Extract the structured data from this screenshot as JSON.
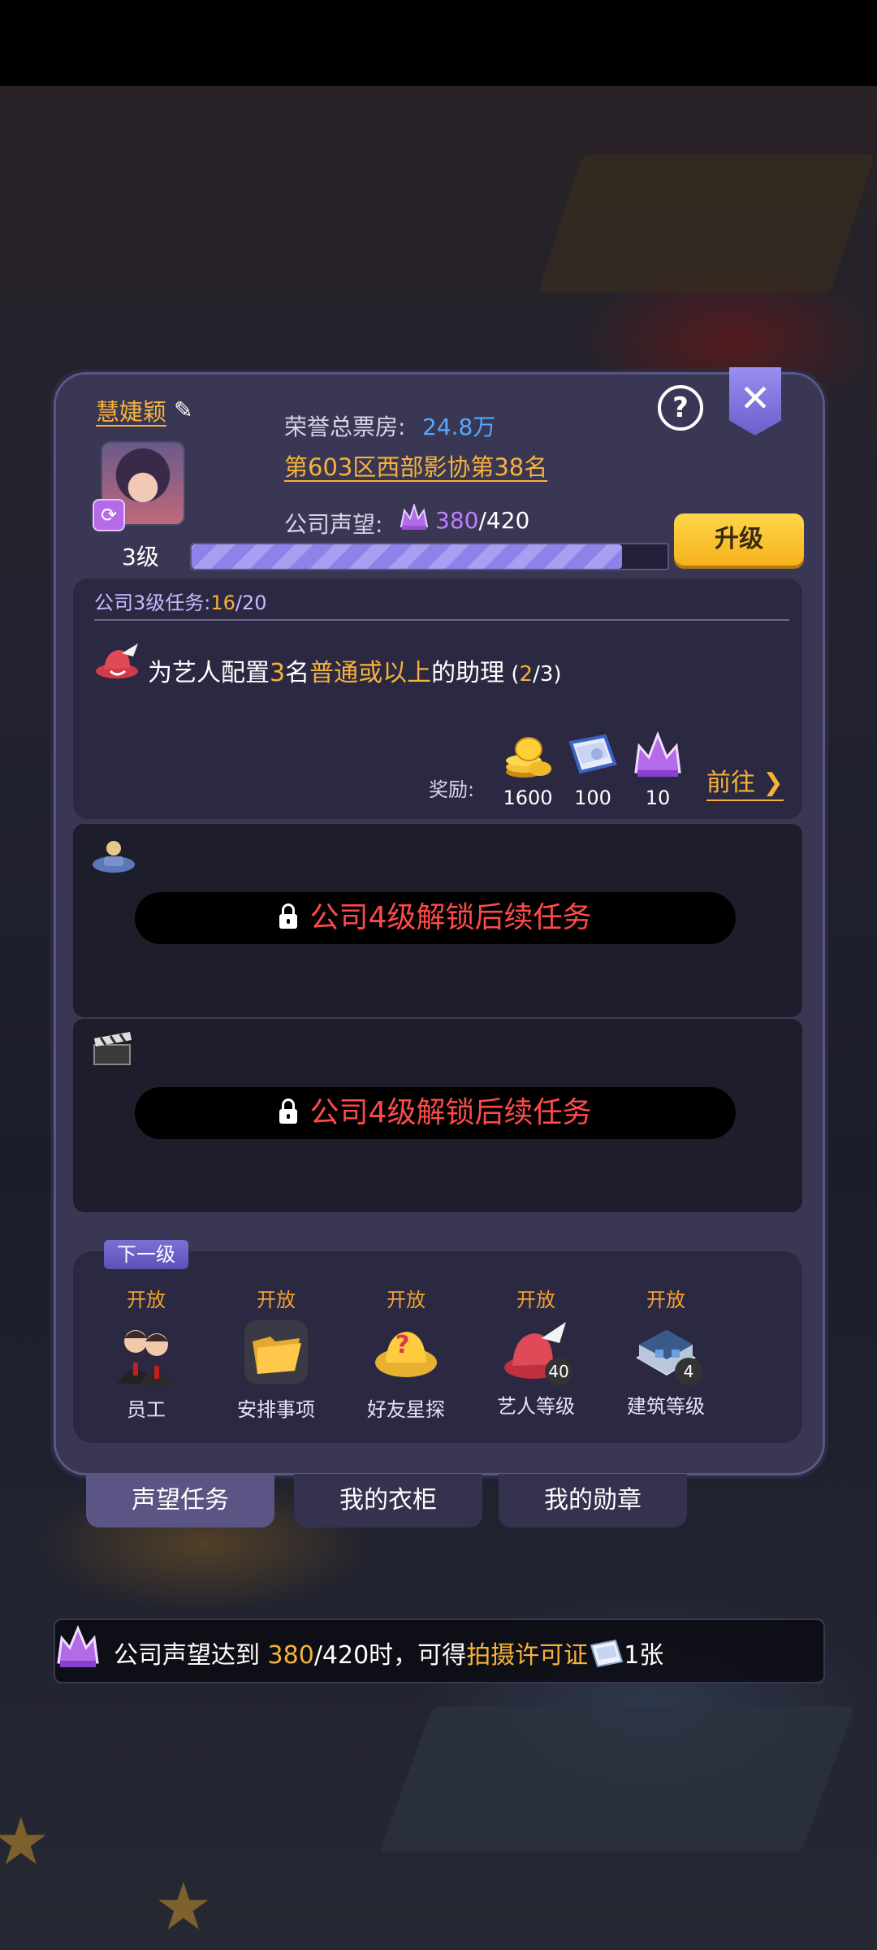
{
  "profile": {
    "name": "慧婕颖",
    "level_text": "3级",
    "box_office_label": "荣誉总票房:",
    "box_office_value": "24.8万",
    "rank_text": "第603区西部影协第38名",
    "reputation_label": "公司声望:",
    "reputation_current": "380",
    "reputation_max": "/420",
    "reputation_fraction": 0.905
  },
  "buttons": {
    "upgrade_label": "升级",
    "help_glyph": "?",
    "close_glyph": "✕",
    "edit_glyph": "✎",
    "swap_glyph": "⟳"
  },
  "task": {
    "header_prefix": "公司3级任务:",
    "header_current": "16",
    "header_max": "/20",
    "text_parts": [
      "为艺人配置",
      "3",
      "名",
      "普通或以上",
      "的助理",
      " (",
      "2",
      "/3)"
    ],
    "reward_label": "奖励:",
    "rewards": [
      {
        "icon": "gold-coins-icon",
        "value": "1600"
      },
      {
        "icon": "permit-scroll-icon",
        "value": "100"
      },
      {
        "icon": "purple-crown-icon",
        "value": "10"
      }
    ],
    "goto_label": "前往"
  },
  "locked": [
    {
      "icon": "assistant-icon",
      "text": "公司4级解锁后续任务"
    },
    {
      "icon": "clapperboard-icon",
      "text": "公司4级解锁后续任务"
    }
  ],
  "next_level": {
    "tag": "下一级",
    "features": [
      {
        "status": "开放",
        "name": "员工",
        "icon": "staff-icon",
        "badge": ""
      },
      {
        "status": "开放",
        "name": "安排事项",
        "icon": "folder-icon",
        "badge": ""
      },
      {
        "status": "开放",
        "name": "好友星探",
        "icon": "scout-icon",
        "badge": ""
      },
      {
        "status": "开放",
        "name": "艺人等级",
        "icon": "artist-hat-icon",
        "badge": "40"
      },
      {
        "status": "开放",
        "name": "建筑等级",
        "icon": "building-icon",
        "badge": "4"
      }
    ]
  },
  "tabs": [
    "声望任务",
    "我的衣柜",
    "我的勋章"
  ],
  "banner": {
    "prefix": "公司声望达到",
    "value": "380",
    "suffix": "/420时，可得",
    "item": "拍摄许可证",
    "count": "1张"
  },
  "colors": {
    "accent_orange": "#f6b23a",
    "accent_purple": "#c07cff",
    "locked_red": "#ff4a4a",
    "link_blue": "#55a8ff"
  }
}
